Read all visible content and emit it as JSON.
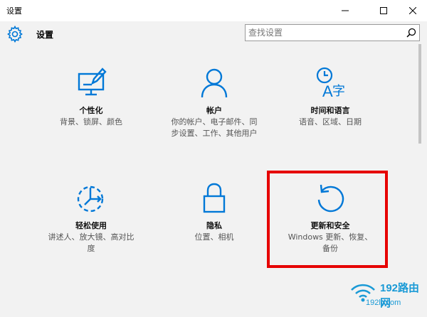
{
  "window": {
    "title": "设置"
  },
  "header": {
    "title": "设置"
  },
  "search": {
    "placeholder": "查找设置"
  },
  "tiles": [
    {
      "label": "个性化",
      "desc": "背景、锁屏、颜色"
    },
    {
      "label": "帐户",
      "desc": "你的帐户、电子邮件、同步设置、工作、其他用户"
    },
    {
      "label": "时间和语言",
      "desc": "语音、区域、日期"
    },
    {
      "label": "轻松使用",
      "desc": "讲述人、放大镜、高对比度"
    },
    {
      "label": "隐私",
      "desc": "位置、相机"
    },
    {
      "label": "更新和安全",
      "desc": "Windows 更新、恢复、备份"
    }
  ],
  "watermark": {
    "brand": "192路由网",
    "site": "192ly.com"
  },
  "colors": {
    "accent": "#0078d7",
    "highlight": "#e60000",
    "background": "#f2f2f2"
  }
}
